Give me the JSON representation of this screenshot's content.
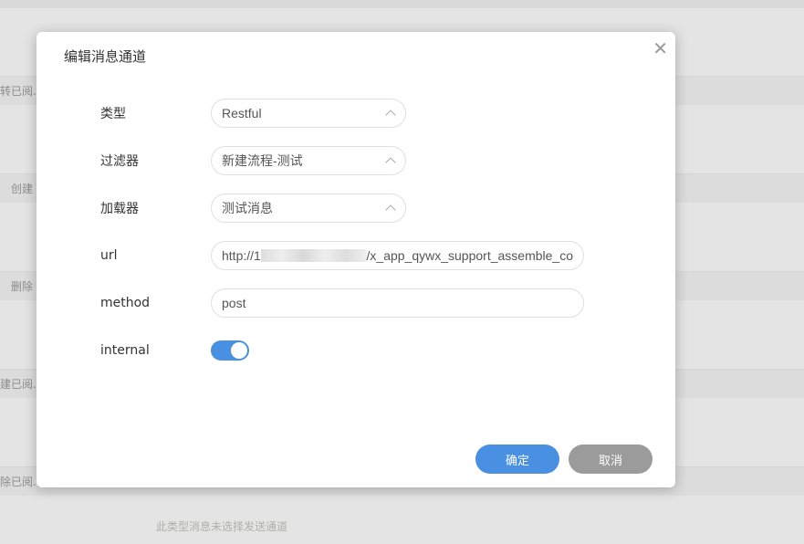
{
  "background": {
    "snippets": [
      "转已阅.(r",
      "创建",
      "删除",
      "建已阅.(r",
      "除已阅.(r"
    ],
    "empty_notice": "此类型消息未选择发送通道"
  },
  "dialog": {
    "title": "编辑消息通道",
    "fields": {
      "type": {
        "label": "类型",
        "value": "Restful"
      },
      "filter": {
        "label": "过滤器",
        "value": "新建流程-测试"
      },
      "loader": {
        "label": "加载器",
        "value": "测试消息"
      },
      "url": {
        "label": "url",
        "prefix": "http://1",
        "suffix": "/x_app_qywx_support_assemble_co"
      },
      "method": {
        "label": "method",
        "value": "post"
      },
      "internal": {
        "label": "internal",
        "enabled": true
      }
    },
    "confirm_label": "确定",
    "cancel_label": "取消"
  }
}
